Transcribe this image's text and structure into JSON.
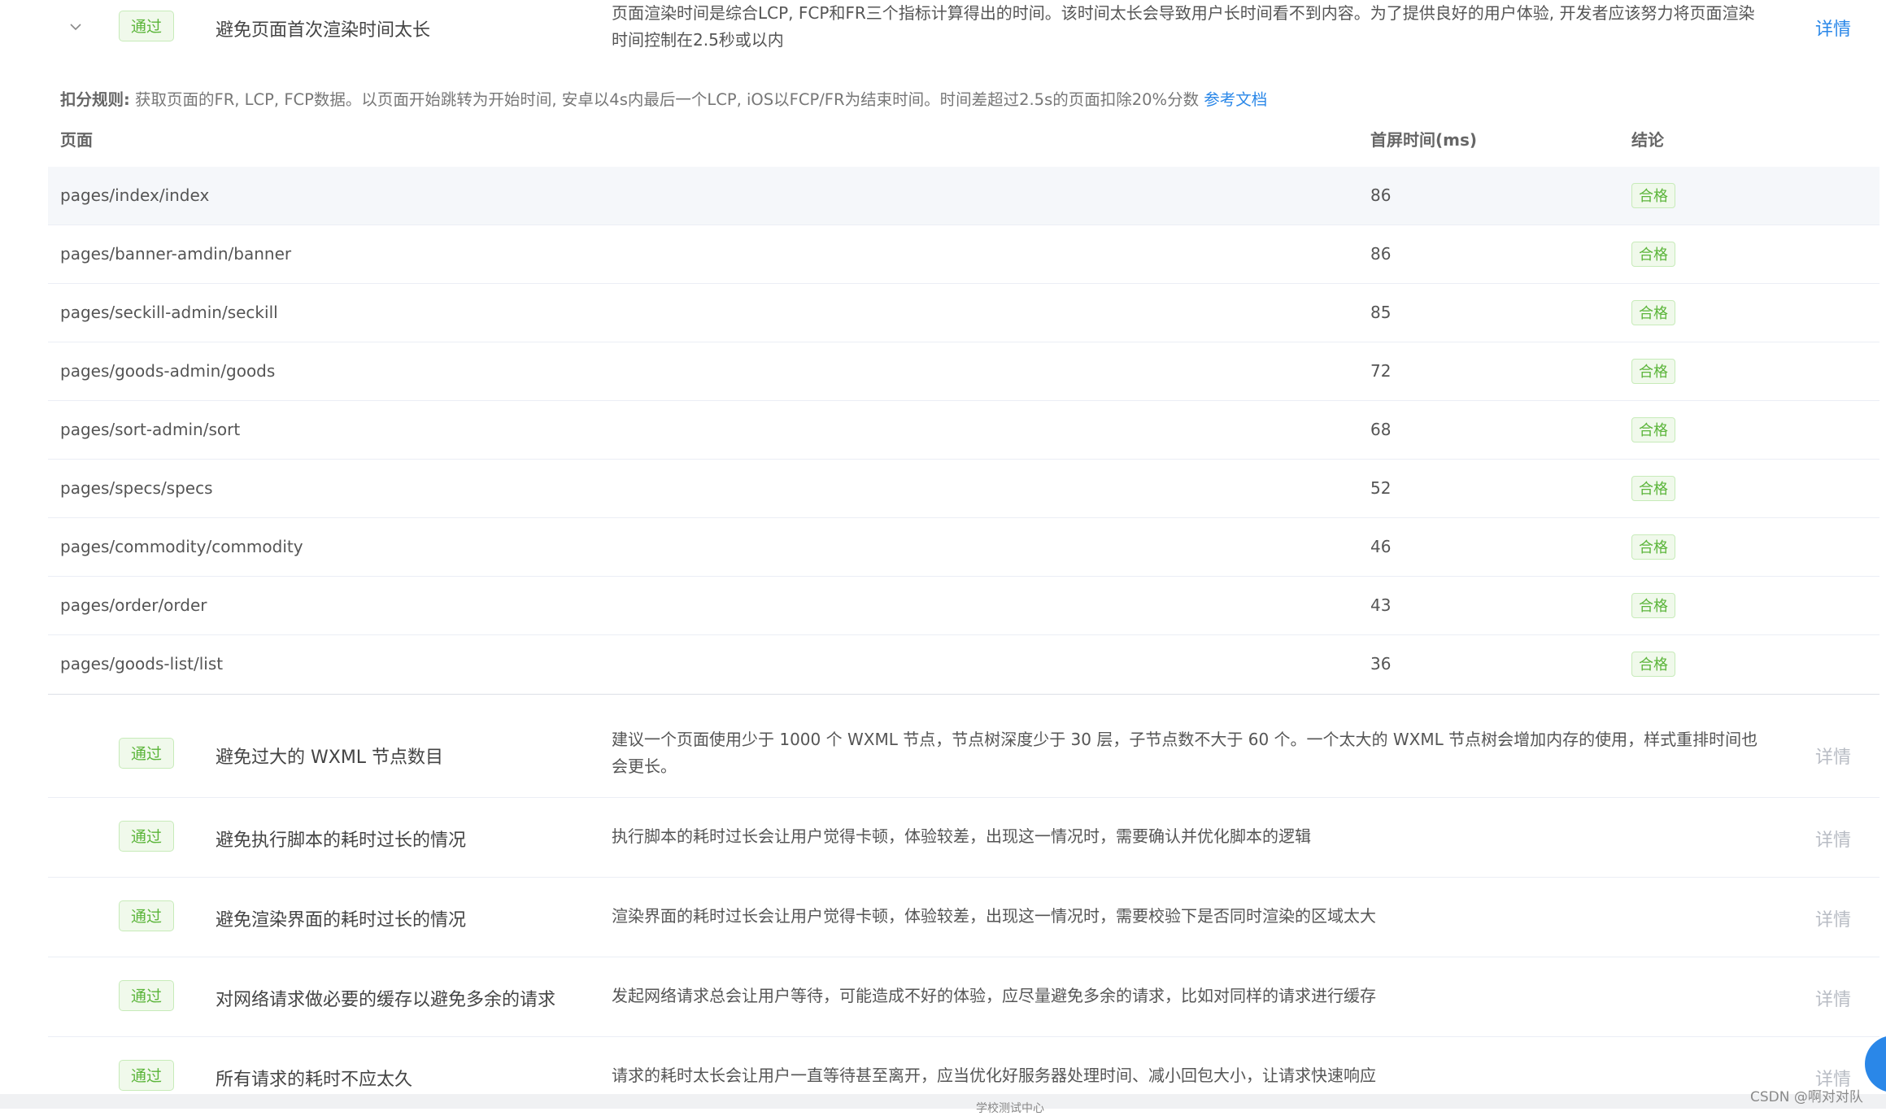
{
  "audit_top": {
    "status_tag": "通过",
    "title": "避免页面首次渲染时间太长",
    "description": "页面渲染时间是综合LCP, FCP和FR三个指标计算得出的时间。该时间太长会导致用户长时间看不到内容。为了提供良好的用户体验, 开发者应该努力将页面渲染时间控制在2.5秒或以内",
    "detail_label": "详情"
  },
  "rule": {
    "label": "扣分规则:",
    "text": "获取页面的FR, LCP, FCP数据。以页面开始跳转为开始时间, 安卓以4s内最后一个LCP, iOS以FCP/FR为结束时间。时间差超过2.5s的页面扣除20%分数",
    "link": "参考文档"
  },
  "table": {
    "headers": {
      "page": "页面",
      "time": "首屏时间(ms)",
      "result": "结论"
    },
    "rows": [
      {
        "page": "pages/index/index",
        "time": "86",
        "result": "合格"
      },
      {
        "page": "pages/banner-amdin/banner",
        "time": "86",
        "result": "合格"
      },
      {
        "page": "pages/seckill-admin/seckill",
        "time": "85",
        "result": "合格"
      },
      {
        "page": "pages/goods-admin/goods",
        "time": "72",
        "result": "合格"
      },
      {
        "page": "pages/sort-admin/sort",
        "time": "68",
        "result": "合格"
      },
      {
        "page": "pages/specs/specs",
        "time": "52",
        "result": "合格"
      },
      {
        "page": "pages/commodity/commodity",
        "time": "46",
        "result": "合格"
      },
      {
        "page": "pages/order/order",
        "time": "43",
        "result": "合格"
      },
      {
        "page": "pages/goods-list/list",
        "time": "36",
        "result": "合格"
      }
    ]
  },
  "audits": [
    {
      "status_tag": "通过",
      "title": "避免过大的 WXML 节点数目",
      "description": "建议一个页面使用少于 1000 个 WXML 节点，节点树深度少于 30 层，子节点数不大于 60 个。一个太大的 WXML 节点树会增加内存的使用，样式重排时间也会更长。",
      "detail_label": "详情"
    },
    {
      "status_tag": "通过",
      "title": "避免执行脚本的耗时过长的情况",
      "description": "执行脚本的耗时过长会让用户觉得卡顿，体验较差，出现这一情况时，需要确认并优化脚本的逻辑",
      "detail_label": "详情"
    },
    {
      "status_tag": "通过",
      "title": "避免渲染界面的耗时过长的情况",
      "description": "渲染界面的耗时过长会让用户觉得卡顿，体验较差，出现这一情况时，需要校验下是否同时渲染的区域太大",
      "detail_label": "详情"
    },
    {
      "status_tag": "通过",
      "title": "对网络请求做必要的缓存以避免多余的请求",
      "description": "发起网络请求总会让用户等待，可能造成不好的体验，应尽量避免多余的请求，比如对同样的请求进行缓存",
      "detail_label": "详情"
    },
    {
      "status_tag": "通过",
      "title": "所有请求的耗时不应太久",
      "description": "请求的耗时太长会让用户一直等待甚至离开，应当优化好服务器处理时间、减小回包大小，让请求快速响应",
      "detail_label": "详情"
    }
  ],
  "footer": {
    "text": "学校测试中心"
  },
  "watermark": "CSDN @啊对对队"
}
